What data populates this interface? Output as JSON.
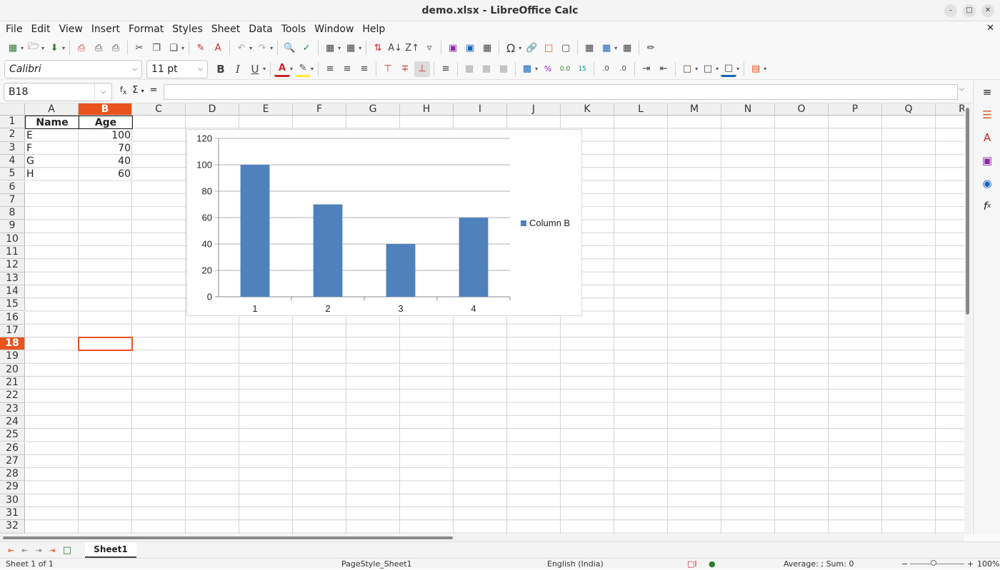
{
  "window": {
    "title": "demo.xlsx - LibreOffice Calc"
  },
  "menu": [
    "File",
    "Edit",
    "View",
    "Insert",
    "Format",
    "Styles",
    "Sheet",
    "Data",
    "Tools",
    "Window",
    "Help"
  ],
  "formatting": {
    "font_name": "Calibri",
    "font_size": "11 pt"
  },
  "formula_bar": {
    "cell_ref": "B18",
    "formula": ""
  },
  "columns": [
    "A",
    "B",
    "C",
    "D",
    "E",
    "F",
    "G",
    "H",
    "I",
    "J",
    "K",
    "L",
    "M",
    "N",
    "O",
    "P",
    "Q",
    "R"
  ],
  "rows": [
    "1",
    "2",
    "3",
    "4",
    "5",
    "6",
    "7",
    "8",
    "9",
    "10",
    "11",
    "12",
    "13",
    "14",
    "15",
    "16",
    "17",
    "18",
    "19",
    "20",
    "21",
    "22",
    "23",
    "24",
    "25",
    "26",
    "27",
    "28",
    "29",
    "30",
    "31",
    "32"
  ],
  "cells": {
    "a1": "Name",
    "b1": "Age",
    "a2": "E",
    "b2": "100",
    "a3": "F",
    "b3": "70",
    "a4": "G",
    "b4": "40",
    "a5": "H",
    "b5": "60"
  },
  "chart_data": {
    "type": "bar",
    "categories": [
      "1",
      "2",
      "3",
      "4"
    ],
    "series": [
      {
        "name": "Column B",
        "values": [
          100,
          70,
          40,
          60
        ],
        "color": "#4f81bd"
      }
    ],
    "ylim": [
      0,
      120
    ],
    "yticks": [
      0,
      20,
      40,
      60,
      80,
      100,
      120
    ],
    "grid": true,
    "legend": "right",
    "title": "",
    "xlabel": "",
    "ylabel": ""
  },
  "sheet_tabs": [
    "Sheet1"
  ],
  "status": {
    "sheet_info": "Sheet 1 of 1",
    "page_style": "PageStyle_Sheet1",
    "language": "English (India)",
    "summary": "Average: ; Sum: 0",
    "zoom": "100%"
  },
  "colors": {
    "accent": "#e9541d",
    "bar": "#4f81bd"
  }
}
